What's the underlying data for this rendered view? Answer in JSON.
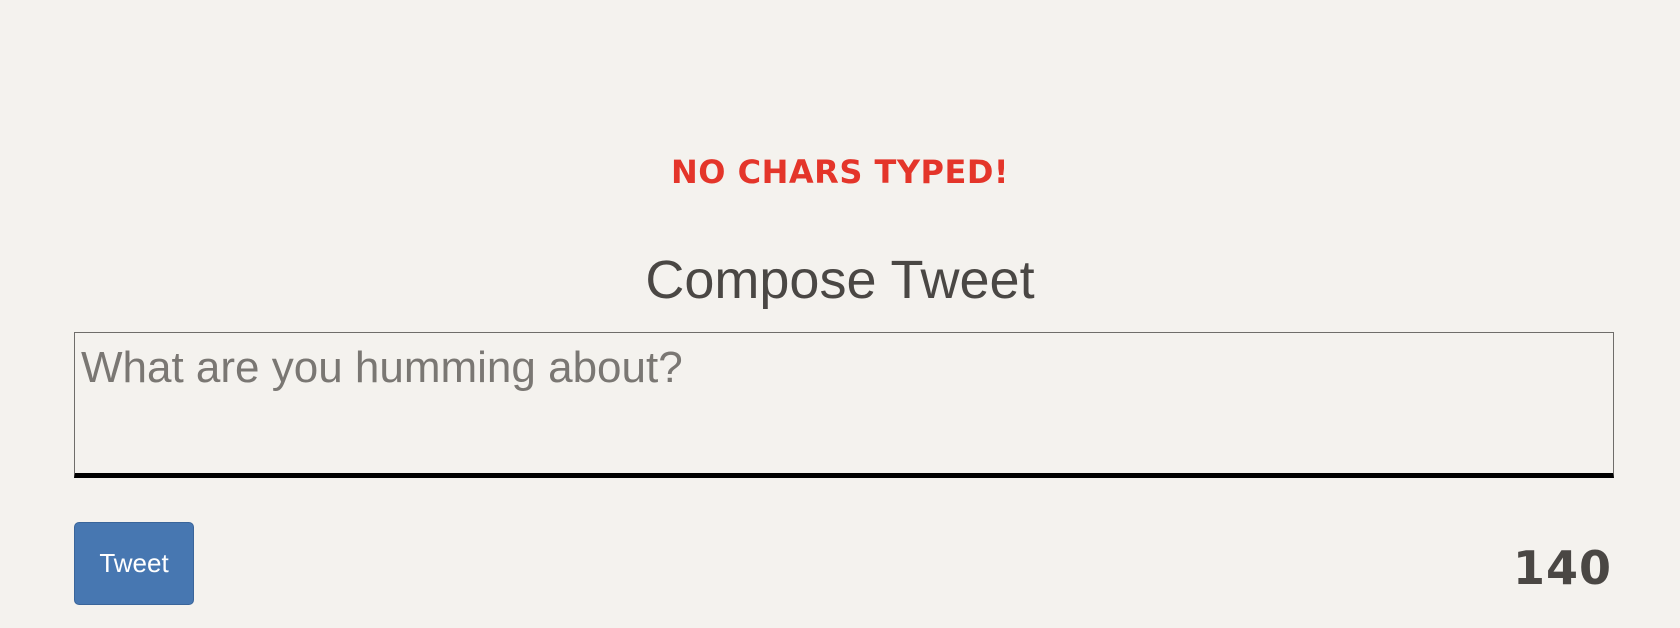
{
  "error": {
    "message": "NO CHARS TYPED!",
    "color": "#e4352a"
  },
  "compose": {
    "title": "Compose Tweet",
    "textarea_placeholder": "What are you humming about?",
    "textarea_value": ""
  },
  "actions": {
    "tweet_label": "Tweet",
    "button_color": "#4777b1"
  },
  "counter": {
    "remaining": "140"
  }
}
